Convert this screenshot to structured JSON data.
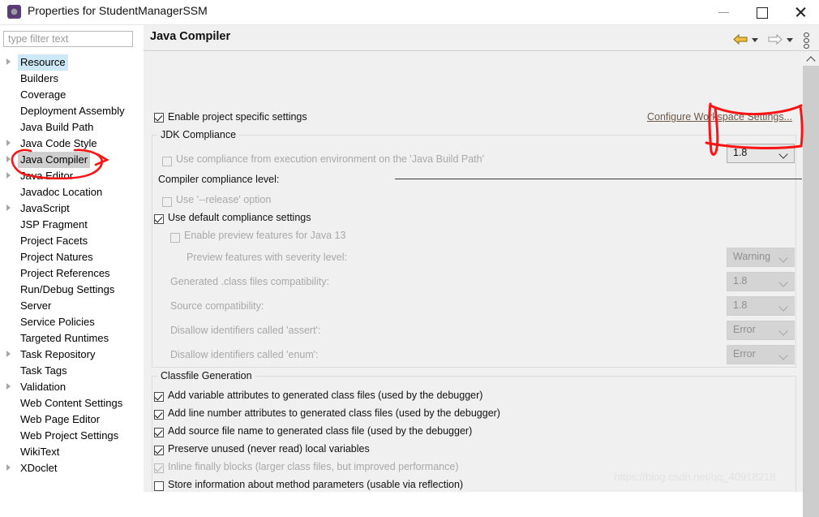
{
  "window": {
    "title": "Properties for StudentManagerSSM",
    "icon": "eclipse-properties-icon",
    "minimize": "–",
    "maximize": "□",
    "close": "✕"
  },
  "sidebar": {
    "filter_placeholder": "type filter text",
    "items": [
      {
        "label": "Resource",
        "expandable": true,
        "selected": "blue"
      },
      {
        "label": "Builders",
        "expandable": false,
        "selected": ""
      },
      {
        "label": "Coverage",
        "expandable": false,
        "selected": ""
      },
      {
        "label": "Deployment Assembly",
        "expandable": false,
        "selected": ""
      },
      {
        "label": "Java Build Path",
        "expandable": false,
        "selected": ""
      },
      {
        "label": "Java Code Style",
        "expandable": true,
        "selected": ""
      },
      {
        "label": "Java Compiler",
        "expandable": true,
        "selected": "gray"
      },
      {
        "label": "Java Editor",
        "expandable": true,
        "selected": ""
      },
      {
        "label": "Javadoc Location",
        "expandable": false,
        "selected": ""
      },
      {
        "label": "JavaScript",
        "expandable": true,
        "selected": ""
      },
      {
        "label": "JSP Fragment",
        "expandable": false,
        "selected": ""
      },
      {
        "label": "Project Facets",
        "expandable": false,
        "selected": ""
      },
      {
        "label": "Project Natures",
        "expandable": false,
        "selected": ""
      },
      {
        "label": "Project References",
        "expandable": false,
        "selected": ""
      },
      {
        "label": "Run/Debug Settings",
        "expandable": false,
        "selected": ""
      },
      {
        "label": "Server",
        "expandable": false,
        "selected": ""
      },
      {
        "label": "Service Policies",
        "expandable": false,
        "selected": ""
      },
      {
        "label": "Targeted Runtimes",
        "expandable": false,
        "selected": ""
      },
      {
        "label": "Task Repository",
        "expandable": true,
        "selected": ""
      },
      {
        "label": "Task Tags",
        "expandable": false,
        "selected": ""
      },
      {
        "label": "Validation",
        "expandable": true,
        "selected": ""
      },
      {
        "label": "Web Content Settings",
        "expandable": false,
        "selected": ""
      },
      {
        "label": "Web Page Editor",
        "expandable": false,
        "selected": ""
      },
      {
        "label": "Web Project Settings",
        "expandable": false,
        "selected": ""
      },
      {
        "label": "WikiText",
        "expandable": false,
        "selected": ""
      },
      {
        "label": "XDoclet",
        "expandable": true,
        "selected": ""
      }
    ]
  },
  "content": {
    "title": "Java Compiler",
    "nav_back_icon": "back-arrow-icon",
    "nav_forward_icon": "forward-arrow-icon",
    "menu_icon": "view-menu-icon",
    "enable_project_specific": "Enable project specific settings",
    "enable_project_specific_checked": true,
    "configure_workspace_link": "Configure Workspace Settings...",
    "jdk_group": {
      "title": "JDK Compliance",
      "use_compliance_from_env": "Use compliance from execution environment on the 'Java Build Path'",
      "use_compliance_from_env_checked": false,
      "compiler_compliance_level_label": "Compiler compliance level:",
      "compiler_compliance_level_value": "1.8",
      "use_release_option": "Use '--release' option",
      "use_release_option_checked": false,
      "use_default_compliance": "Use default compliance settings",
      "use_default_compliance_checked": true,
      "enable_preview_features": "Enable preview features for Java 13",
      "enable_preview_features_checked": false,
      "preview_severity_label": "Preview features with severity level:",
      "preview_severity_value": "Warning",
      "generated_class_label": "Generated .class files compatibility:",
      "generated_class_value": "1.8",
      "source_compat_label": "Source compatibility:",
      "source_compat_value": "1.8",
      "disallow_assert_label": "Disallow identifiers called 'assert':",
      "disallow_assert_value": "Error",
      "disallow_enum_label": "Disallow identifiers called 'enum':",
      "disallow_enum_value": "Error"
    },
    "classfile_group": {
      "title": "Classfile Generation",
      "options": [
        {
          "label": "Add variable attributes to generated class files (used by the debugger)",
          "checked": true,
          "enabled": true
        },
        {
          "label": "Add line number attributes to generated class files (used by the debugger)",
          "checked": true,
          "enabled": true
        },
        {
          "label": "Add source file name to generated class file (used by the debugger)",
          "checked": true,
          "enabled": true
        },
        {
          "label": "Preserve unused (never read) local variables",
          "checked": true,
          "enabled": true
        },
        {
          "label": "Inline finally blocks (larger class files, but improved performance)",
          "checked": true,
          "enabled": false
        },
        {
          "label": "Store information about method parameters (usable via reflection)",
          "checked": false,
          "enabled": true
        }
      ]
    }
  },
  "annotations": {
    "color": "#fa1414",
    "ellipse_target": "Java Compiler",
    "box_target": "compiler-compliance-level-combo",
    "arrow_from": "Compiler compliance level:",
    "arrow_to": "1.8"
  },
  "watermark": "https://blog.csdn.net/qq_40918218"
}
